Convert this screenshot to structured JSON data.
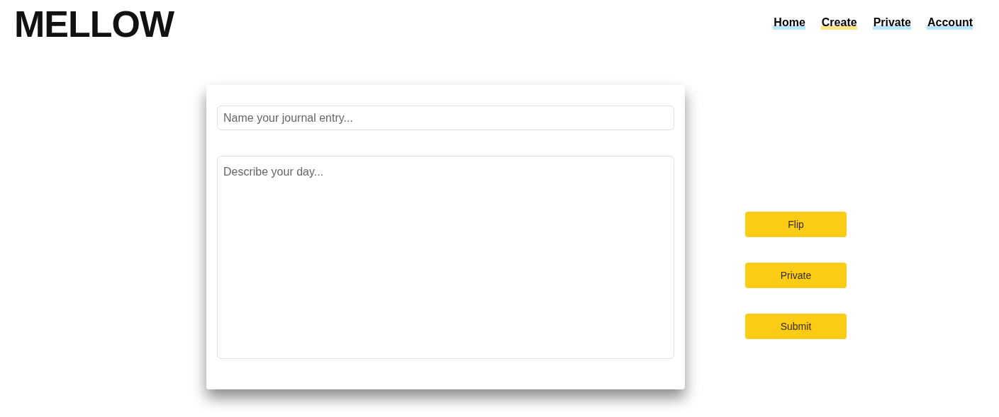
{
  "logo": "MELLOW",
  "nav": [
    {
      "label": "Home",
      "selected": false
    },
    {
      "label": "Create",
      "selected": true
    },
    {
      "label": "Private",
      "selected": false
    },
    {
      "label": "Account",
      "selected": false
    }
  ],
  "form": {
    "title_placeholder": "Name your journal entry...",
    "body_placeholder": "Describe your day..."
  },
  "buttons": [
    "Flip",
    "Private",
    "Submit"
  ]
}
